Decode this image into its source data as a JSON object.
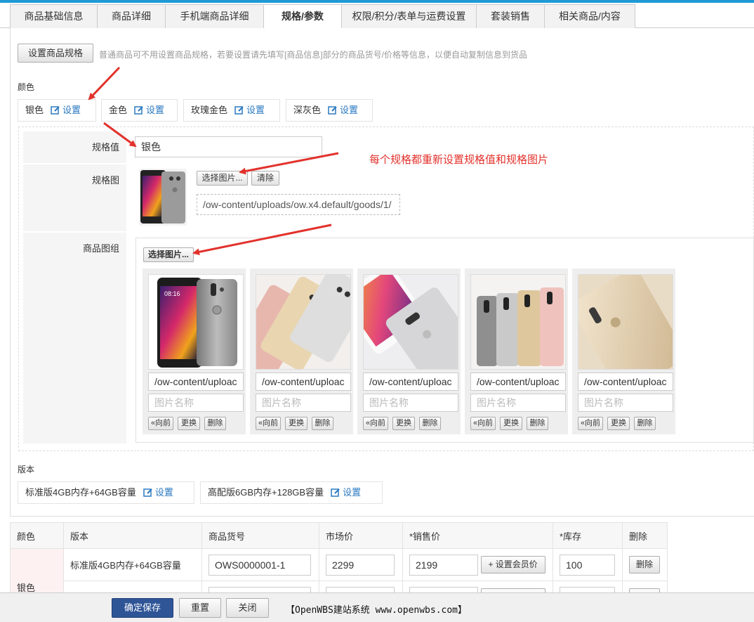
{
  "tabs": [
    {
      "label": "商品基础信息",
      "active": false
    },
    {
      "label": "商品详细",
      "active": false
    },
    {
      "label": "手机端商品详细",
      "active": false
    },
    {
      "label": "规格/参数",
      "active": true
    },
    {
      "label": "权限/积分/表单与运费设置",
      "active": false
    },
    {
      "label": "套装销售",
      "active": false
    },
    {
      "label": "相关商品/内容",
      "active": false
    }
  ],
  "spec_header": {
    "button_label": "设置商品规格",
    "hint": "普通商品可不用设置商品规格，若要设置请先填写[商品信息]部分的商品货号/价格等信息，以便自动复制信息到货品"
  },
  "color_group": {
    "title": "颜色",
    "set_label": "设置",
    "options": [
      "银色",
      "金色",
      "玫瑰金色",
      "深灰色"
    ]
  },
  "editor": {
    "value_label": "规格值",
    "value": "银色",
    "image_label": "规格图",
    "choose_image": "选择图片...",
    "clear": "清除",
    "image_path": "/ow-content/uploads/ow.x4.default/goods/1/",
    "gallery_label": "商品图组",
    "gallery_choose": "选择图片...",
    "gallery_items": [
      {
        "path": "/ow-content/uploac",
        "name_placeholder": "图片名称"
      },
      {
        "path": "/ow-content/uploac",
        "name_placeholder": "图片名称"
      },
      {
        "path": "/ow-content/uploac",
        "name_placeholder": "图片名称"
      },
      {
        "path": "/ow-content/uploac",
        "name_placeholder": "图片名称"
      },
      {
        "path": "/ow-content/uploac",
        "name_placeholder": "图片名称"
      }
    ],
    "item_buttons": {
      "prev": "«向前",
      "replace": "更换",
      "delete": "删除"
    }
  },
  "annotation": "每个规格都重新设置规格值和规格图片",
  "version_group": {
    "title": "版本",
    "set_label": "设置",
    "options": [
      "标准版4GB内存+64GB容量",
      "高配版6GB内存+128GB容量"
    ]
  },
  "sku_table": {
    "headers": [
      "颜色",
      "版本",
      "商品货号",
      "市场价",
      "*销售价",
      "*库存",
      "删除"
    ],
    "rows": [
      {
        "color": "银色",
        "version": "标准版4GB内存+64GB容量",
        "sku": "OWS0000001-1",
        "market_price": "2299",
        "sale_price": "2199",
        "member_price_button": "+ 设置会员价",
        "stock": "100",
        "delete": "删除"
      }
    ]
  },
  "footer": {
    "save": "确定保存",
    "reset": "重置",
    "close": "关闭",
    "brand": "【OpenWBS建站系统 www.openwbs.com】"
  },
  "colors": {
    "accent": "#1f9ad6",
    "primary_button": "#2f5597",
    "link": "#2a78c0",
    "annotation": "#e2322c"
  }
}
